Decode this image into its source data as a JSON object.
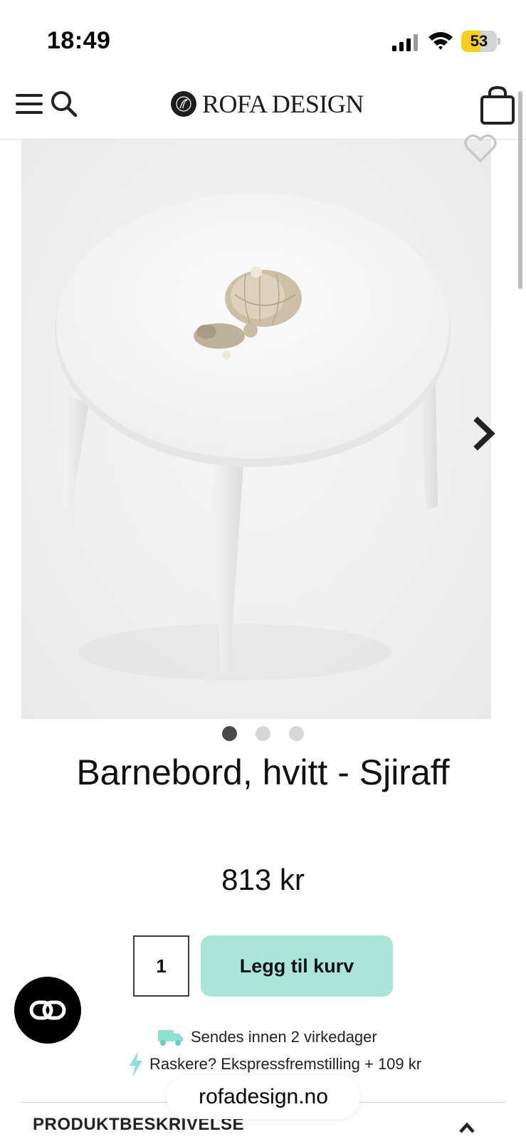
{
  "status_bar": {
    "time": "18:49",
    "battery_level": "53",
    "battery_color": "#f6cf1c"
  },
  "header": {
    "logo_text": "ROFA DESIGN",
    "icons": [
      "menu-icon",
      "search-icon",
      "shopping-bag-icon"
    ]
  },
  "gallery": {
    "image_count": 3,
    "active_index": 0,
    "icons": [
      "heart-icon",
      "chevron-right-icon"
    ]
  },
  "product": {
    "title": "Barnebord, hvitt - Sjiraff",
    "price": "813 kr",
    "quantity": "1",
    "add_to_cart_label": "Legg til kurv",
    "add_button_color": "#a9e6d8"
  },
  "delivery": {
    "shipping_text": "Sendes innen 2 virkedager",
    "express_text": "Raskere? Ekspressfremstilling + 109 kr",
    "accent_color": "#8fe0d0"
  },
  "accordion": {
    "label": "PRODUKTBESKRIVELSE"
  },
  "browser": {
    "url": "rofadesign.no"
  }
}
